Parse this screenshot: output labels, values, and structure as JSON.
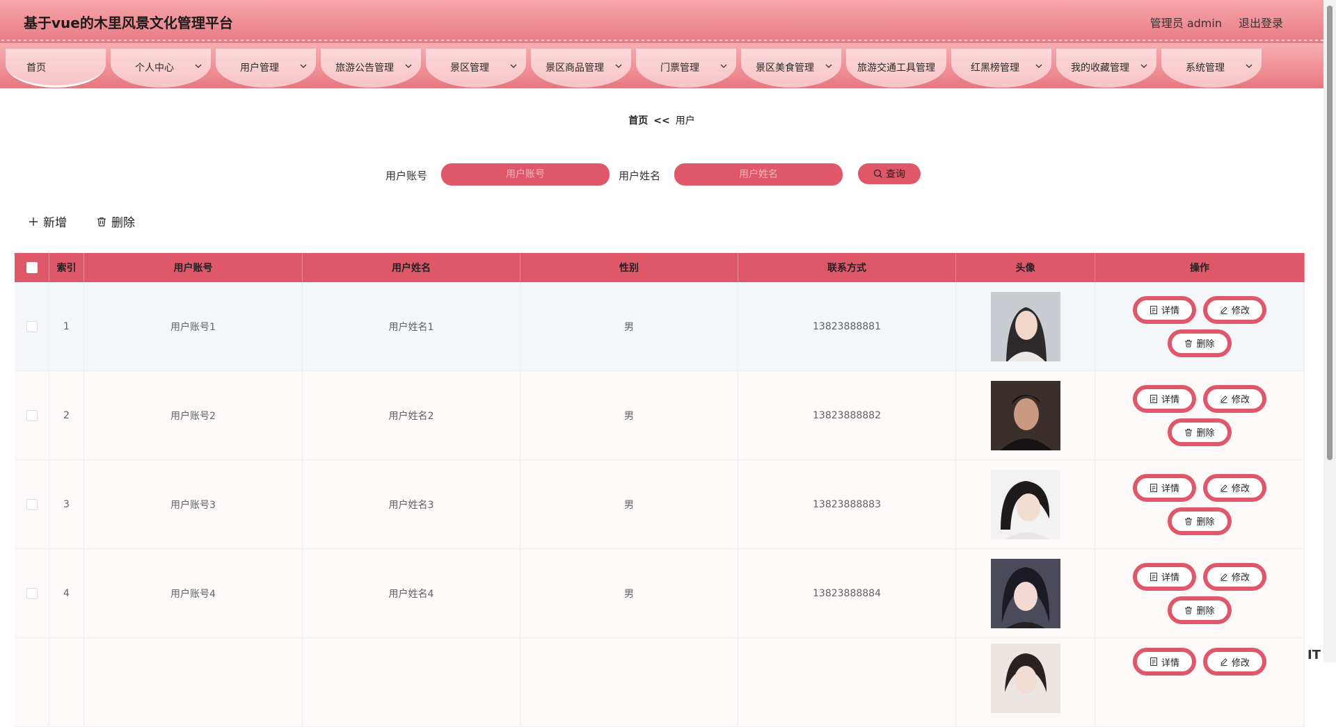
{
  "header": {
    "title": "基于vue的木里风景文化管理平台",
    "user_label": "管理员 admin",
    "logout_label": "退出登录"
  },
  "nav": {
    "items": [
      {
        "label": "首页",
        "has_dropdown": false
      },
      {
        "label": "个人中心",
        "has_dropdown": true
      },
      {
        "label": "用户管理",
        "has_dropdown": true
      },
      {
        "label": "旅游公告管理",
        "has_dropdown": true
      },
      {
        "label": "景区管理",
        "has_dropdown": true
      },
      {
        "label": "景区商品管理",
        "has_dropdown": true
      },
      {
        "label": "门票管理",
        "has_dropdown": true
      },
      {
        "label": "景区美食管理",
        "has_dropdown": true
      },
      {
        "label": "旅游交通工具管理",
        "has_dropdown": false
      },
      {
        "label": "红黑榜管理",
        "has_dropdown": true
      },
      {
        "label": "我的收藏管理",
        "has_dropdown": true
      },
      {
        "label": "系统管理",
        "has_dropdown": true
      }
    ],
    "active": "首页"
  },
  "breadcrumb": {
    "home": "首页",
    "separator": "<<",
    "current": "用户"
  },
  "search": {
    "account_label": "用户账号",
    "account_placeholder": "用户账号",
    "name_label": "用户姓名",
    "name_placeholder": "用户姓名",
    "query_label": "查询"
  },
  "actions": {
    "add_label": "新增",
    "delete_label": "删除"
  },
  "table": {
    "headers": {
      "index": "索引",
      "account": "用户账号",
      "name": "用户姓名",
      "gender": "性别",
      "phone": "联系方式",
      "avatar": "头像",
      "ops": "操作"
    },
    "rows": [
      {
        "index": "1",
        "account": "用户账号1",
        "name": "用户姓名1",
        "gender": "男",
        "phone": "13823888881"
      },
      {
        "index": "2",
        "account": "用户账号2",
        "name": "用户姓名2",
        "gender": "男",
        "phone": "13823888882"
      },
      {
        "index": "3",
        "account": "用户账号3",
        "name": "用户姓名3",
        "gender": "男",
        "phone": "13823888883"
      },
      {
        "index": "4",
        "account": "用户账号4",
        "name": "用户姓名4",
        "gender": "男",
        "phone": "13823888884"
      },
      {
        "index": "",
        "account": "",
        "name": "",
        "gender": "",
        "phone": ""
      }
    ],
    "row_actions": {
      "detail": "详情",
      "edit": "修改",
      "delete": "删除"
    }
  },
  "watermark": "IT",
  "colors": {
    "accent": "#df5869",
    "header_top": "#f8a6aa",
    "header_bottom": "#e87a83",
    "tab_bg": "#fcd8da"
  }
}
